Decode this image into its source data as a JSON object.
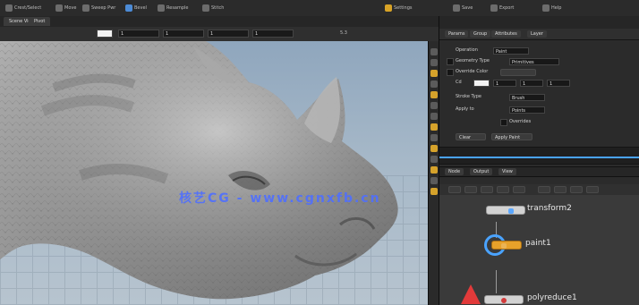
{
  "watermark": "核艺CG - www.cgnxfb.cn",
  "topbar": {
    "items": [
      "Crest/Select",
      "Move",
      "Sweep Pwr",
      "Bevel",
      "Resample",
      "Stitch"
    ],
    "right_items": [
      "Settings",
      "Save",
      "Export",
      "Help"
    ]
  },
  "viewport": {
    "tabs": [
      "Scene View",
      "Pivot"
    ],
    "field_values": [
      "1",
      "1",
      "1",
      "1",
      "5.3"
    ],
    "zoom": "5.3"
  },
  "right_panel": {
    "tabs": [
      "Params",
      "Group",
      "Attributes",
      "Layer"
    ],
    "rows": [
      {
        "label": "Operation",
        "value": "Paint"
      },
      {
        "label": "Geometry Type",
        "value": "Primitives"
      },
      {
        "label": "Override Color",
        "value": ""
      },
      {
        "label": "Cd",
        "value": "1"
      },
      {
        "label": "Stroke Type",
        "value": "Brush"
      },
      {
        "label": "Apply to",
        "value": "Points"
      },
      {
        "label": "Overrides",
        "value": "Enabled"
      }
    ],
    "buttons": [
      "Clear",
      "Apply Paint"
    ]
  },
  "network": {
    "tabs": [
      "Node",
      "Output",
      "View"
    ],
    "nodes": [
      {
        "name": "transform2",
        "color": "#5aa7ff"
      },
      {
        "name": "paint1",
        "color": "#e7a12a"
      },
      {
        "name": "polyreduce1",
        "color": "#d23b3b"
      }
    ]
  },
  "colors": {
    "accent": "#d8a326",
    "selection": "#4aa3ff",
    "danger": "#e23a3a"
  }
}
